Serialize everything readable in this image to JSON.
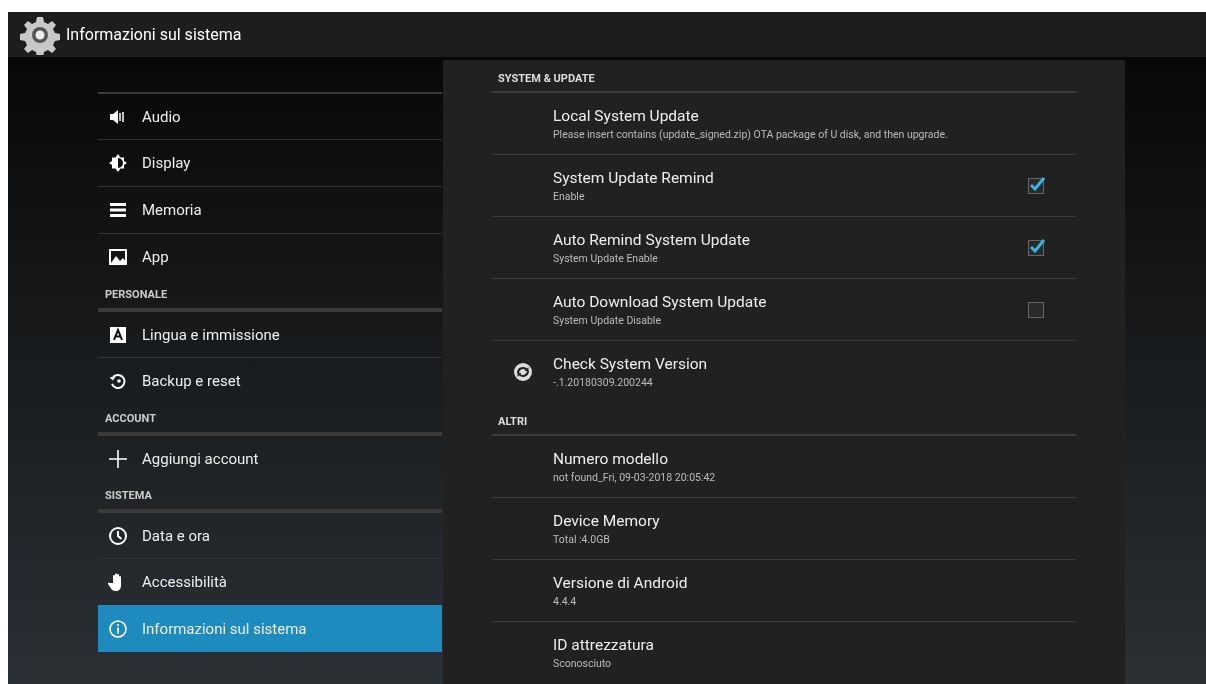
{
  "action_bar": {
    "title": "Informazioni sul sistema"
  },
  "sidebar": {
    "sections": [
      {
        "items": [
          {
            "label": "Audio",
            "selected": false
          },
          {
            "label": "Display",
            "selected": false
          },
          {
            "label": "Memoria",
            "selected": false
          },
          {
            "label": "App",
            "selected": false
          }
        ]
      },
      {
        "header": "PERSONALE",
        "items": [
          {
            "label": "Lingua e immissione",
            "selected": false
          },
          {
            "label": "Backup e reset",
            "selected": false
          }
        ]
      },
      {
        "header": "ACCOUNT",
        "items": [
          {
            "label": "Aggiungi account",
            "selected": false
          }
        ]
      },
      {
        "header": "SISTEMA",
        "items": [
          {
            "label": "Data e ora",
            "selected": false
          },
          {
            "label": "Accessibilità",
            "selected": false
          },
          {
            "label": "Informazioni sul sistema",
            "selected": true
          }
        ]
      }
    ]
  },
  "panel": {
    "sections": [
      {
        "header": "SYSTEM & UPDATE",
        "rows": [
          {
            "kind": "text",
            "title": "Local System Update",
            "summary": "Please insert contains (update_signed.zip) OTA package of U disk, and then upgrade."
          },
          {
            "kind": "checkbox",
            "title": "System Update Remind",
            "summary": "Enable",
            "checked": true
          },
          {
            "kind": "checkbox",
            "title": "Auto Remind System Update",
            "summary": "System Update Enable",
            "checked": true
          },
          {
            "kind": "checkbox",
            "title": "Auto Download System Update",
            "summary": "System Update Disable",
            "checked": false
          },
          {
            "kind": "icon",
            "title": "Check System Version",
            "summary": "-.1.20180309.200244"
          }
        ]
      },
      {
        "header": "ALTRI",
        "rows": [
          {
            "kind": "text",
            "title": "Numero modello",
            "summary": "not found_Fri, 09-03-2018 20:05:42"
          },
          {
            "kind": "text",
            "title": "Device Memory",
            "summary": "Total :4.0GB"
          },
          {
            "kind": "text",
            "title": "Versione di Android",
            "summary": "4.4.4"
          },
          {
            "kind": "text",
            "title": "ID attrezzatura",
            "summary": "Sconosciuto"
          }
        ]
      }
    ]
  }
}
